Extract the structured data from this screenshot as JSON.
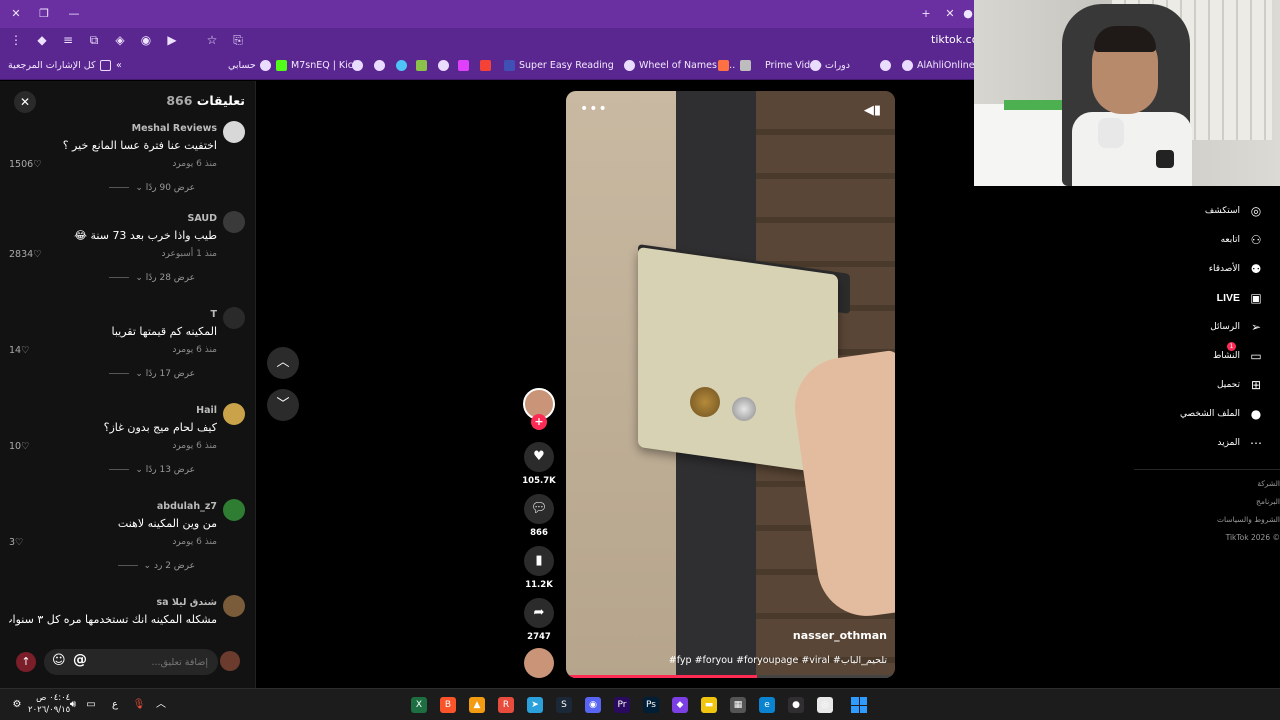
{
  "browser": {
    "url": "tiktok.com",
    "bookmarks": [
      {
        "label": "كل الإشارات المرجعية"
      },
      {
        "label": "حسابي"
      },
      {
        "label": "M7snEQ | Kick"
      },
      {
        "label": "Super Easy Reading"
      },
      {
        "label": "Wheel of Names | ..."
      },
      {
        "label": "Prime Video"
      },
      {
        "label": "دورات"
      },
      {
        "label": "AlAhliOnline"
      }
    ],
    "colors": {
      "frame": "#6a2fa0",
      "toolbar": "#5a2690"
    }
  },
  "comments": {
    "title": "تعليقات",
    "count": "866",
    "input_placeholder": "إضافة تعليق...",
    "items": [
      {
        "author": "Meshal Reviews",
        "text": "اختفيت عنا فترة عسا المانع خير ؟",
        "time": "منذ 6 يوم",
        "reply": "رد",
        "likes": "1506",
        "more": "عرض 90 ردًا",
        "avatar_color": "#d8d8d8"
      },
      {
        "author": "SAUD",
        "text": "طيب واذا خرب بعد 73 سنة 😂",
        "time": "منذ 1 أسبوع",
        "reply": "رد",
        "likes": "2834",
        "more": "عرض 28 ردًا",
        "avatar_color": "#3a3a3a"
      },
      {
        "author": "T",
        "text": "المكينه كم قيمتها تقريبا",
        "time": "منذ 6 يوم",
        "reply": "رد",
        "likes": "14",
        "more": "عرض 17 ردًا",
        "avatar_color": "#2a2a2a"
      },
      {
        "author": "Hail",
        "text": "كيف لحام ميج بدون غاز؟",
        "time": "منذ 6 يوم",
        "reply": "رد",
        "likes": "10",
        "more": "عرض 13 ردًا",
        "avatar_color": "#c9a24a"
      },
      {
        "author": "abdulah_z7",
        "text": "من وين المكينه لاهنت",
        "time": "منذ 6 يوم",
        "reply": "رد",
        "likes": "3",
        "more": "عرض 2 رد",
        "avatar_color": "#2e7d32"
      },
      {
        "author": "شندق ليلا sa",
        "text": "مشكله المكينه انك تستخدمها مره كل ٣ سنوات .",
        "time": "",
        "reply": "",
        "likes": "",
        "more": "",
        "avatar_color": "#7a5b3a"
      }
    ]
  },
  "video": {
    "username": "nasser_othman",
    "caption": "#fyp #foryou #foryoupage #viral #تلحيم_الباب",
    "progress": 0.58
  },
  "actions": {
    "likes": "105.7K",
    "comments": "866",
    "saves": "11.2K",
    "shares": "2747"
  },
  "sidebar": {
    "items": [
      {
        "label": "استكشف",
        "icon": "compass-icon",
        "glyph": "◎"
      },
      {
        "label": "اتابعه",
        "icon": "user-follow-icon",
        "glyph": "⚇"
      },
      {
        "label": "الأصدقاء",
        "icon": "friends-icon",
        "glyph": "⚉"
      },
      {
        "label": "LIVE",
        "icon": "live-icon",
        "glyph": "▣"
      },
      {
        "label": "الرسائل",
        "icon": "send-icon",
        "glyph": "➢"
      },
      {
        "label": "النشاط",
        "icon": "activity-icon",
        "glyph": "▭"
      },
      {
        "label": "تحميل",
        "icon": "upload-icon",
        "glyph": "⊞"
      },
      {
        "label": "الملف الشخصي",
        "icon": "profile-avatar-icon",
        "glyph": "●"
      },
      {
        "label": "المزيد",
        "icon": "more-icon",
        "glyph": "⋯"
      }
    ],
    "activity_badge": "1",
    "footer": [
      "الشركة",
      "البرنامج",
      "الشروط والسياسات",
      "© 2026 TikTok"
    ]
  },
  "taskbar": {
    "time": "٠٤:٠٤ ص",
    "date": "٢٠٢٦/٠٩/١٥",
    "lang": "ع",
    "apps": [
      "excel-icon",
      "brave-icon",
      "vlc-icon",
      "app-red-icon",
      "telegram-icon",
      "steam-icon",
      "discord-icon",
      "premiere-icon",
      "photoshop-icon",
      "app-purple-icon",
      "files-icon",
      "store-icon",
      "edge-icon",
      "obs-icon",
      "chrome-icon",
      "windows-icon"
    ]
  },
  "accent": "#fe2c55"
}
